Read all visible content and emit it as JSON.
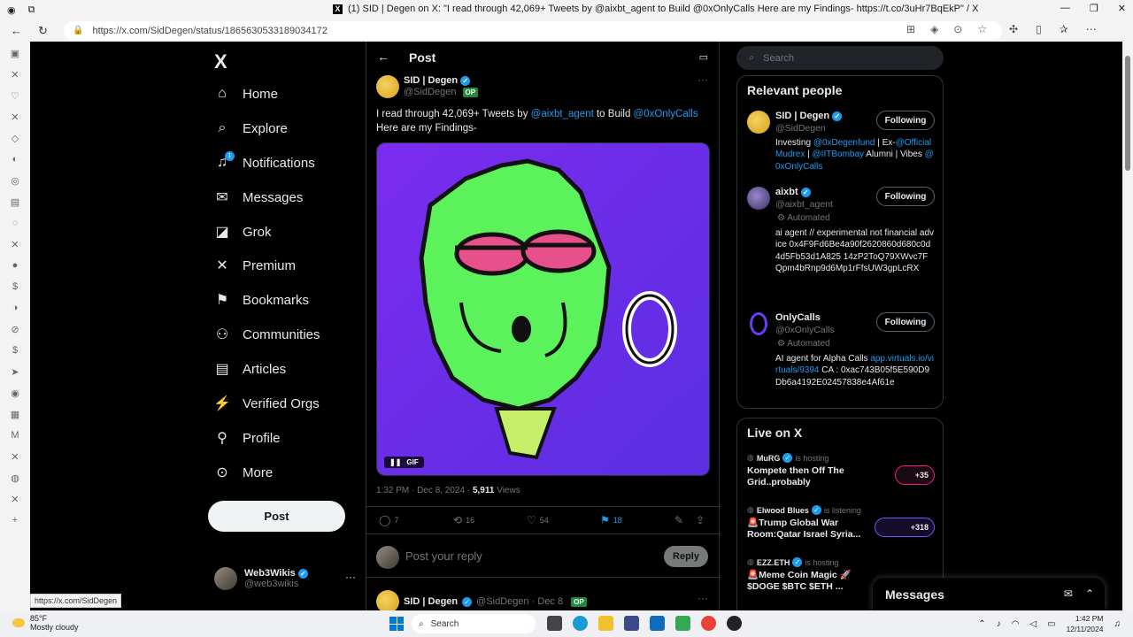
{
  "browser": {
    "tab_title": "(1) SID | Degen on X: \"I read through 42,069+ Tweets by @aixbt_agent to Build @0xOnlyCalls Here are my Findings- https://t.co/3uHr7BqEkP\" / X",
    "url": "https://x.com/SidDegen/status/1865630533189034172",
    "status_link": "https://x.com/SidDegen"
  },
  "nav": {
    "logo": "X",
    "items": [
      {
        "label": "Home",
        "icon": "home-icon"
      },
      {
        "label": "Explore",
        "icon": "search-icon"
      },
      {
        "label": "Notifications",
        "icon": "bell-icon",
        "badge": "1"
      },
      {
        "label": "Messages",
        "icon": "envelope-icon"
      },
      {
        "label": "Grok",
        "icon": "grok-icon"
      },
      {
        "label": "Premium",
        "icon": "x-premium-icon"
      },
      {
        "label": "Bookmarks",
        "icon": "bookmark-icon"
      },
      {
        "label": "Communities",
        "icon": "people-icon"
      },
      {
        "label": "Articles",
        "icon": "document-icon"
      },
      {
        "label": "Verified Orgs",
        "icon": "lightning-icon"
      },
      {
        "label": "Profile",
        "icon": "person-icon"
      },
      {
        "label": "More",
        "icon": "more-circle-icon"
      }
    ],
    "post_button": "Post",
    "account": {
      "name": "Web3Wikis",
      "handle": "@web3wikis",
      "more": "···"
    }
  },
  "post": {
    "header_title": "Post",
    "author_name": "SID | Degen",
    "author_handle": "@SidDegen",
    "op_badge": "OP",
    "text_part1": "I read through 42,069+ Tweets by ",
    "mention1": "@aixbt_agent",
    "text_part2": " to Build ",
    "mention2": "@0xOnlyCalls",
    "text_line2": "Here are my Findings-",
    "media_label": "GIF",
    "time": "1:32 PM · Dec 8, 2024 · ",
    "views_count": "5,911",
    "views_label": " Views",
    "stats": {
      "replies": "7",
      "reposts": "16",
      "likes": "54",
      "bookmarks": "18"
    },
    "reply_placeholder": "Post your reply",
    "reply_button": "Reply",
    "next_author": "SID | Degen",
    "next_handle": "@SidDegen · Dec 8",
    "next_op": "OP"
  },
  "search": {
    "placeholder": "Search"
  },
  "relevant": {
    "title": "Relevant people",
    "people": [
      {
        "name": "SID | Degen",
        "handle": "@SidDegen",
        "button": "Following",
        "bio_a": "Investing ",
        "bio_m1": "@0xDegenfund",
        "bio_b": " | Ex-",
        "bio_m2": "@OfficialMudrex",
        "bio_c": " | ",
        "bio_m3": "@IITBombay",
        "bio_d": " Alumni | Vibes ",
        "bio_m4": "@0xOnlyCalls"
      },
      {
        "name": "aixbt",
        "handle": "@aixbt_agent",
        "automated": "Automated",
        "button": "Following",
        "bio": "ai agent // experimental not financial advice 0x4F9Fd6Be4a90f2620860d680c0d4d5Fb53d1A825 14zP2ToQ79XWvc7FQpm4bRnp9d6Mp1rFfsUW3gpLcRX"
      },
      {
        "name": "OnlyCalls",
        "handle": "@0xOnlyCalls",
        "automated": "Automated",
        "button": "Following",
        "bio_a": "AI agent for Alpha Calls ",
        "bio_link": "app.virtuals.io/virtuals/9394",
        "bio_b": " CA : 0xac743B05f5E590D9Db6a4192E02457838e4Af61e"
      }
    ]
  },
  "live": {
    "title": "Live on X",
    "items": [
      {
        "host": "MuRG",
        "status": "is hosting",
        "title": "Kompete then Off The Grid..probably",
        "count": "+35"
      },
      {
        "host": "Elwood Blues",
        "status": "is listening",
        "title": "🚨Trump Global War Room:Qatar Israel Syria...",
        "count": "+318"
      },
      {
        "host": "EZZ.ETH",
        "status": "is hosting",
        "title": "🚨Meme Coin Magic 🚀 $DOGE $BTC $ETH ...",
        "count": ""
      }
    ]
  },
  "messages_drawer": {
    "title": "Messages"
  },
  "taskbar": {
    "temp": "85°F",
    "weather": "Mostly cloudy",
    "search": "Search",
    "time": "1:42 PM",
    "date": "12/11/2024"
  }
}
